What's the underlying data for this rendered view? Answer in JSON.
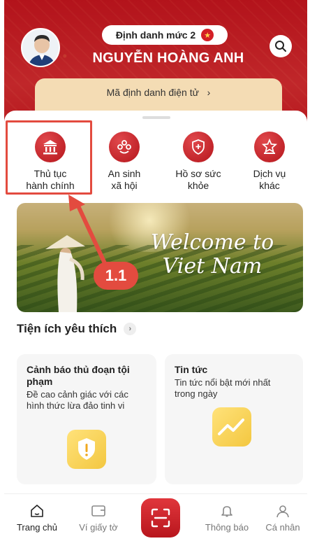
{
  "header": {
    "id_level": "Định danh mức 2",
    "user_name": "NGUYỄN HOÀNG ANH",
    "ident_link": "Mã định danh điện tử"
  },
  "services": [
    {
      "label_line1": "Thủ tục",
      "label_line2": "hành chính",
      "icon": "government-building-icon"
    },
    {
      "label_line1": "An sinh",
      "label_line2": "xã hội",
      "icon": "social-welfare-icon"
    },
    {
      "label_line1": "Hồ sơ sức",
      "label_line2": "khỏe",
      "icon": "health-shield-icon"
    },
    {
      "label_line1": "Dịch vụ",
      "label_line2": "khác",
      "icon": "other-services-icon"
    }
  ],
  "banner": {
    "line1": "Welcome to",
    "line2": "Viet Nam"
  },
  "annotation": {
    "callout": "1.1",
    "color": "#e34b3f"
  },
  "favorites": {
    "title": "Tiện ích yêu thích",
    "cards": [
      {
        "title": "Cảnh báo thủ đoạn tội phạm",
        "desc": "Đề cao cảnh giác với các hình thức lừa đảo tinh vi"
      },
      {
        "title": "Tin tức",
        "desc": "Tin tức nổi bật mới nhất trong ngày"
      }
    ]
  },
  "tabbar": {
    "home": "Trang chủ",
    "wallet": "Ví giấy tờ",
    "notifications": "Thông báo",
    "profile": "Cá nhân"
  },
  "colors": {
    "brand_red": "#c0272a",
    "ident_card_bg": "#f4dcb4"
  }
}
